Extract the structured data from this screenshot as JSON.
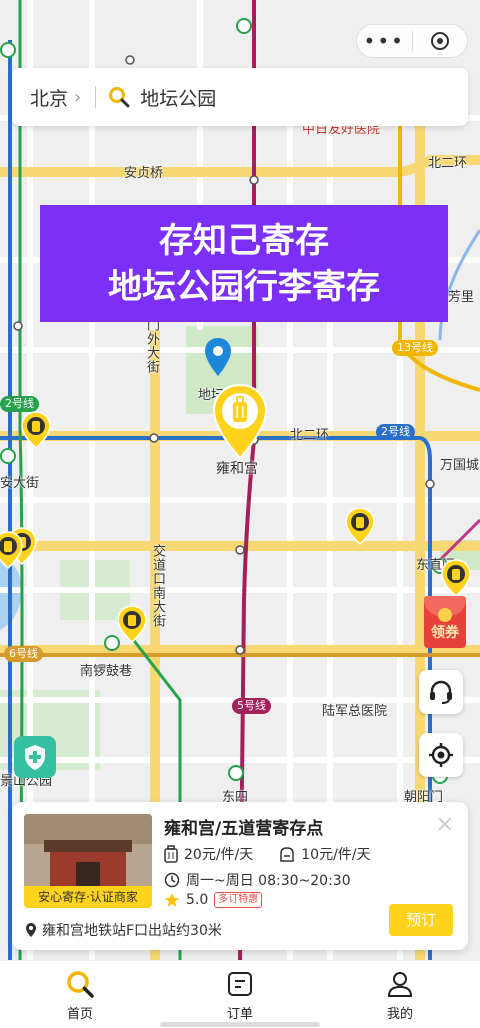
{
  "topbar": {
    "menu_dots": "•••"
  },
  "search": {
    "city": "北京",
    "city_chevron": "›",
    "query": "地坛公园"
  },
  "banner": {
    "line1": "存知己寄存",
    "line2": "地坛公园行李寄存"
  },
  "map": {
    "labels": {
      "anzhen": "安贞桥",
      "beierhuan": "北二环",
      "beierhuan2": "北二环",
      "hospital": "中日友好医院",
      "yonghegong": "雍和宫",
      "ditan": "地坛公园",
      "andingmen_outer": "门外大街",
      "andajie": "安大街",
      "wanguo": "万国城",
      "fangli": "芳里",
      "dongzhimen": "东直门",
      "jiaodaokou": "交道口南大街",
      "nanluoguxiang": "南锣鼓巷",
      "lujun": "陆军总医院",
      "dongsi": "东四",
      "chaoyangmen": "朝阳门",
      "jingshan": "景山公园"
    },
    "lines": {
      "line13": "13号线",
      "line2": "2号线",
      "line2_left": "2号线",
      "line6": "6号线",
      "line5": "5号线"
    }
  },
  "coupon": {
    "label": "领券"
  },
  "store_card": {
    "name": "雍和宫/五道营寄存点",
    "badge": "安心寄存·认证商家",
    "price_suitcase": "20元/件/天",
    "price_bag": "10元/件/天",
    "hours": "周一~周日 08:30~20:30",
    "rating": "5.0",
    "discount_tag": "多订特惠",
    "location": "雍和宫地铁站F口出站约30米",
    "book_label": "预订",
    "close_icon": "×"
  },
  "tabs": [
    {
      "label": "首页"
    },
    {
      "label": "订单"
    },
    {
      "label": "我的"
    }
  ],
  "colors": {
    "accent": "#ffd21c",
    "banner": "#7b2ff7",
    "line2": "#2c6fc9",
    "line5": "#a3205a",
    "line13": "#f2b500"
  }
}
